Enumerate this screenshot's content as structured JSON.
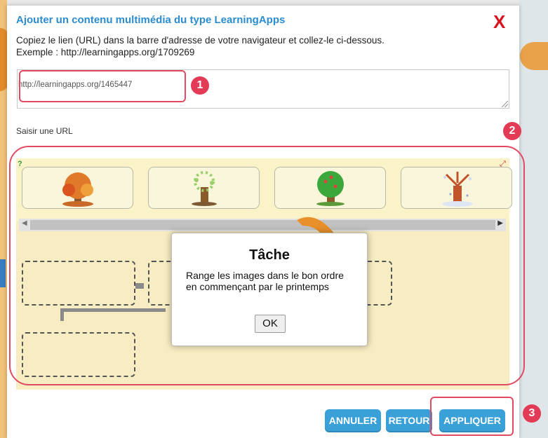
{
  "modal": {
    "title": "Ajouter un contenu multimédia du type LearningApps",
    "close_label": "X",
    "instruction_line1": "Copiez le lien (URL) dans la barre d'adresse de votre navigateur et collez-le ci-dessous.",
    "instruction_line2": "Exemple : http://learningapps.org/1709269",
    "url_value": "http://learningapps.org/1465447",
    "url_label": "Saisir une URL"
  },
  "app": {
    "help_icon": "?",
    "expand_icon": "⤢",
    "cards": [
      {
        "name": "autumn-tree",
        "colors": {
          "leaves": "#e07a2a",
          "trunk": "#8b5a2b"
        }
      },
      {
        "name": "spring-tree",
        "colors": {
          "leaves": "#9bcf6b",
          "trunk": "#8b5a2b"
        }
      },
      {
        "name": "summer-tree",
        "colors": {
          "leaves": "#3aa83a",
          "trunk": "#8b5a2b"
        }
      },
      {
        "name": "winter-tree",
        "colors": {
          "leaves": "#cfd8ec",
          "trunk": "#c0552b"
        }
      }
    ],
    "task": {
      "title": "Tâche",
      "text": "Range les images dans le bon ordre en commençant par le printemps",
      "ok_label": "OK"
    }
  },
  "buttons": {
    "cancel": "ANNULER",
    "back": "RETOUR",
    "apply": "APPLIQUER"
  },
  "badges": [
    "1",
    "2",
    "3"
  ],
  "colors": {
    "accent": "#2b8ccf",
    "highlight": "#e14a63",
    "button": "#3aa0d8",
    "close": "#d9141f"
  }
}
